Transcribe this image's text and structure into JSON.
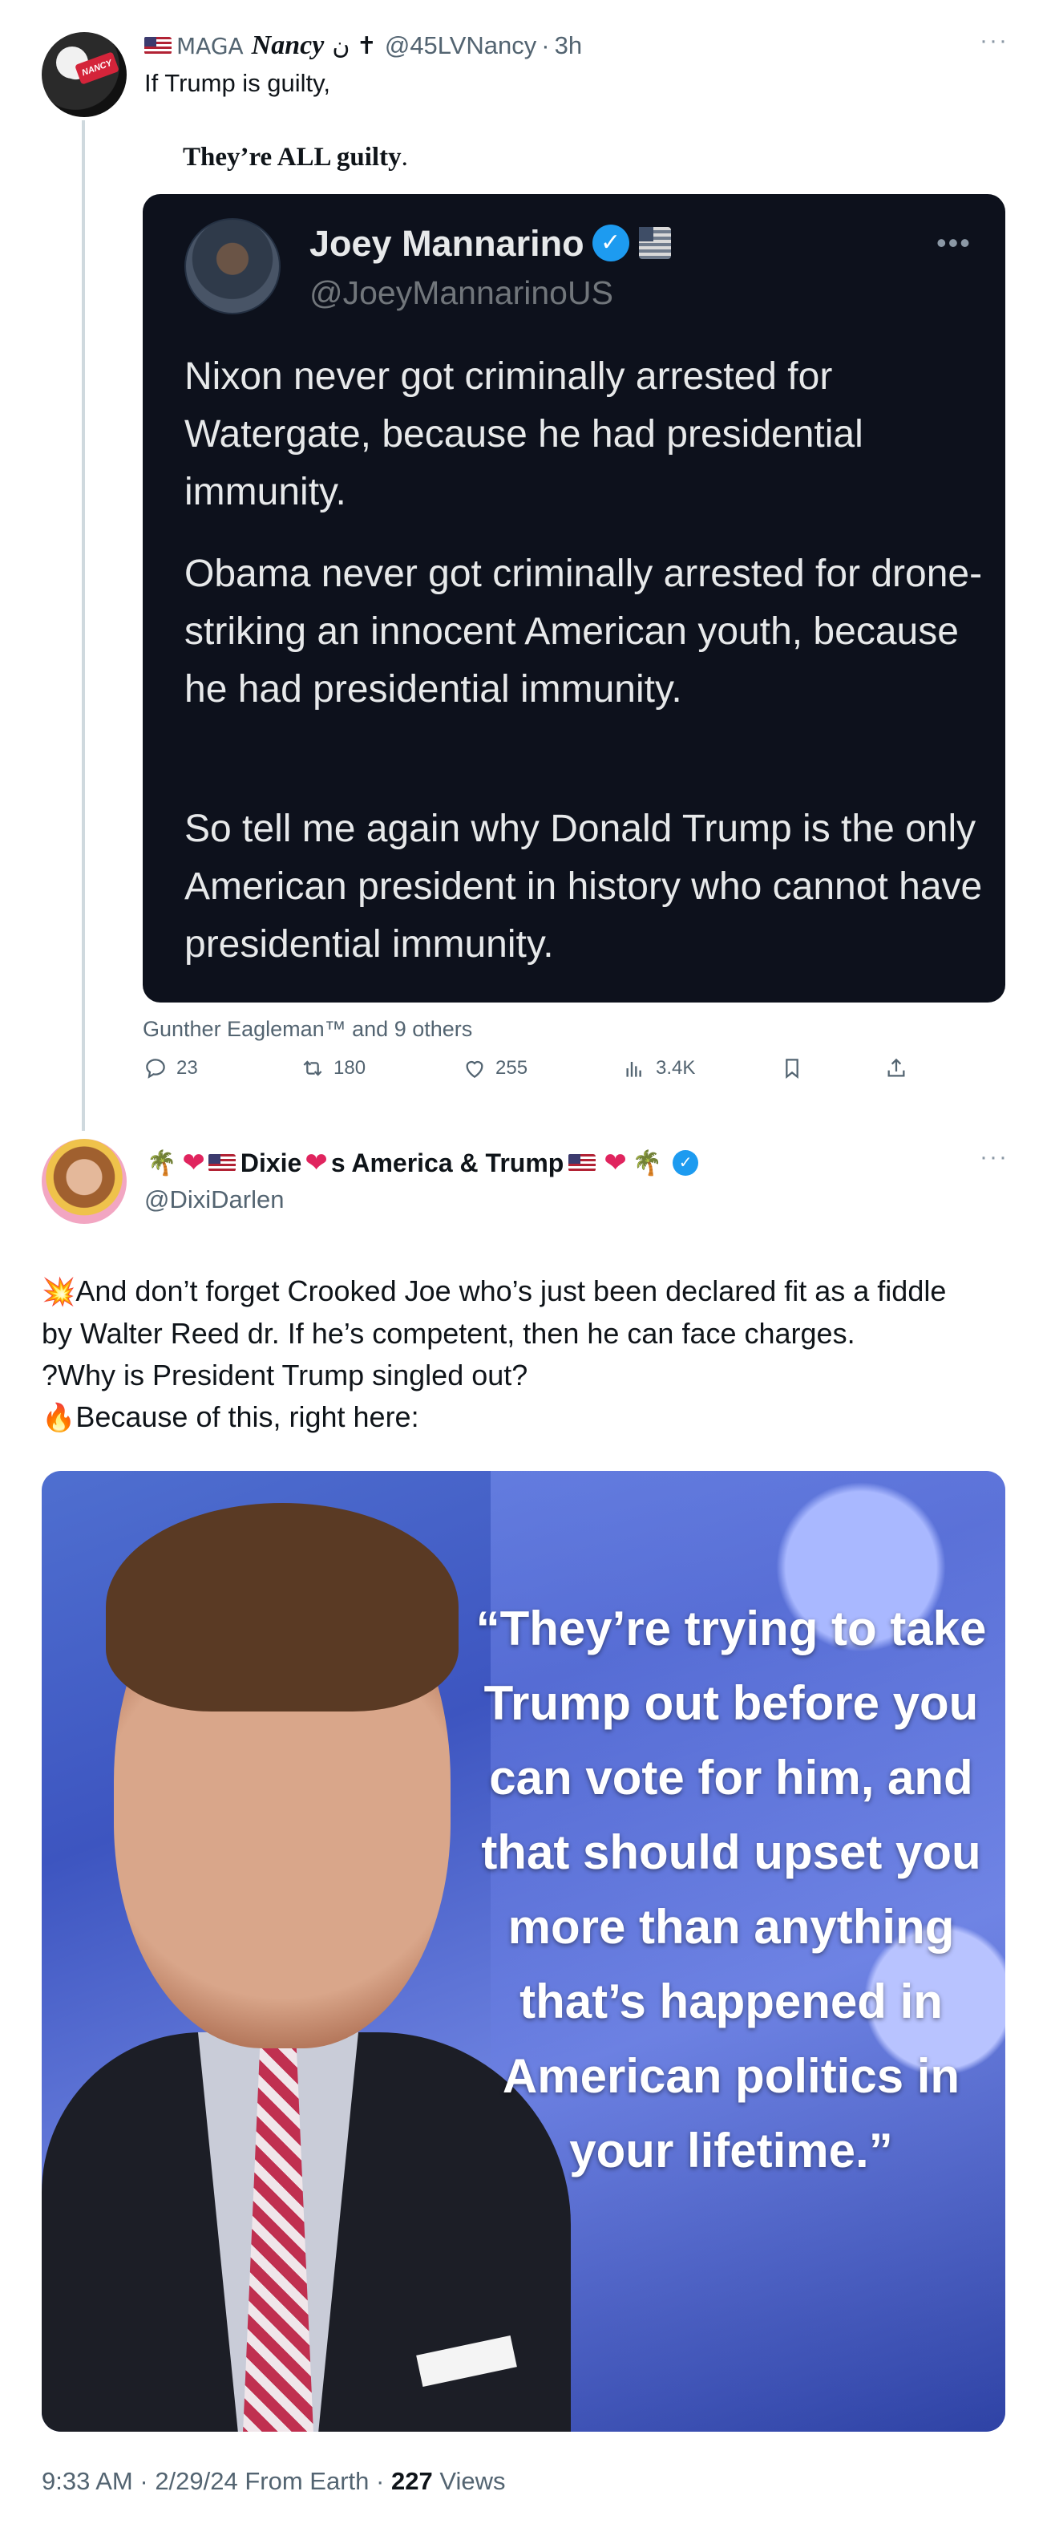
{
  "tweet1": {
    "flag_icon": "us-flag-icon",
    "name_prefix": "MAGA",
    "name": "Nancy",
    "name_suffix": "ن ✝",
    "handle": "@45LVNancy",
    "sep": "·",
    "time": "3h",
    "more": "···",
    "text": "If Trump is guilty,",
    "subtext_bold": "They’re ALL guilty",
    "subtext_end": ".",
    "quoted": {
      "name": "Joey Mannarino",
      "handle": "@JoeyMannarinoUS",
      "more": "•••",
      "paragraphs": [
        "Nixon never got criminally arrested for Watergate, because he had presidential immunity.",
        "Obama never got criminally arrested for drone-striking an innocent American youth, because he had presidential immunity.",
        "So tell me again why Donald Trump is the only American president in history who cannot have presidential immunity."
      ]
    },
    "liked_by": "Gunther Eagleman™ and 9 others",
    "actions": {
      "replies": "23",
      "reposts": "180",
      "likes": "255",
      "views": "3.4K"
    }
  },
  "tweet2": {
    "name_lead": "Dixie",
    "name_rest": "s America & Trump",
    "handle": "@DixiDarlen",
    "more": "···",
    "body": {
      "line1": "And don’t forget Crooked Joe who’s just been declared fit as a fiddle",
      "line2": "by Walter Reed dr. If he’s competent, then he can face charges.",
      "line3": "?Why is President Trump singled out?",
      "line4": "Because of this, right here:"
    },
    "image_quote": "“They’re trying to take Trump out before you can vote for him, and that should upset you more than anything that’s happened in American politics in your lifetime.”",
    "footer": {
      "time": "9:33 AM",
      "date": "2/29/24",
      "source": "From Earth",
      "views_count": "227",
      "views_label": "Views"
    }
  },
  "colors": {
    "accent": "#1d9bf0",
    "secondary_text": "#536471",
    "card_bg": "#0d111c"
  }
}
